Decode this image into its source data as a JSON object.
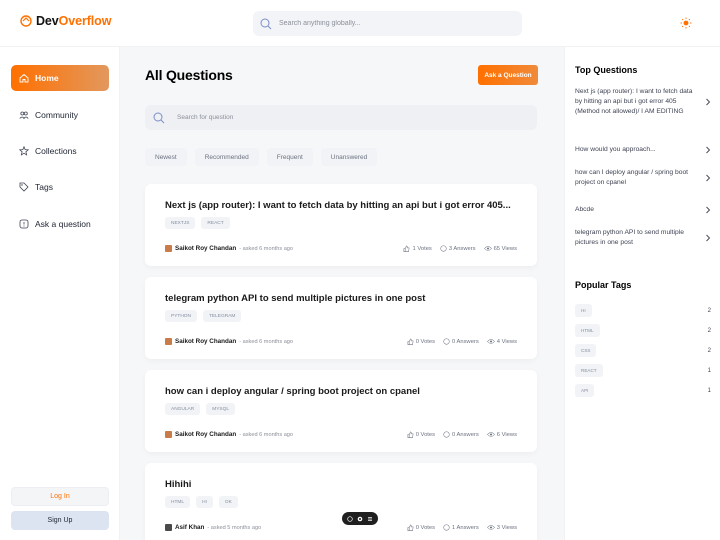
{
  "header": {
    "logo_prefix": "Dev",
    "logo_suffix": "Overflow",
    "search_placeholder": "Search anything globally..."
  },
  "sidebar": {
    "items": [
      {
        "label": "Home",
        "icon": "home-icon",
        "active": true
      },
      {
        "label": "Community",
        "icon": "users-icon",
        "active": false
      },
      {
        "label": "Collections",
        "icon": "star-icon",
        "active": false
      },
      {
        "label": "Tags",
        "icon": "tag-icon",
        "active": false
      },
      {
        "label": "Ask a question",
        "icon": "question-icon",
        "active": false
      }
    ],
    "login_label": "Log In",
    "signup_label": "Sign Up"
  },
  "main": {
    "title": "All Questions",
    "ask_button": "Ask a Question",
    "search_placeholder": "Search for question",
    "filters": [
      "Newest",
      "Recommended",
      "Frequent",
      "Unanswered"
    ],
    "questions": [
      {
        "title": "Next js (app router): I want to fetch data by hitting an api but i got error 405...",
        "tags": [
          "NEXTJS",
          "REACT"
        ],
        "author": "Saikot Roy Chandan",
        "time": "- asked 6 months ago",
        "votes": "1 Votes",
        "answers": "3 Answers",
        "views": "65 Views"
      },
      {
        "title": "telegram python API to send multiple pictures in one post",
        "tags": [
          "PYTHON",
          "TELEGRAM"
        ],
        "author": "Saikot Roy Chandan",
        "time": "- asked 6 months ago",
        "votes": "0 Votes",
        "answers": "0 Answers",
        "views": "4 Views"
      },
      {
        "title": "how can i deploy angular / spring boot project on cpanel",
        "tags": [
          "ANGULAR",
          "MYSQL"
        ],
        "author": "Saikot Roy Chandan",
        "time": "- asked 6 months ago",
        "votes": "0 Votes",
        "answers": "0 Answers",
        "views": "6 Views"
      },
      {
        "title": "Hihihi",
        "tags": [
          "HTML",
          "HI",
          "OK"
        ],
        "author": "Asif Khan",
        "time": "- asked 5 months ago",
        "votes": "0 Votes",
        "answers": "1 Answers",
        "views": "3 Views"
      }
    ]
  },
  "right": {
    "top_questions_title": "Top Questions",
    "top_questions": [
      "Next js (app router): I want to fetch data by hitting an api but i got error 405 (Method not allowed)/ I AM EDITING",
      "How would you approach...",
      "how can I deploy angular / spring boot project on cpanel",
      "Abcde",
      "telegram python API to send multiple pictures in one post"
    ],
    "popular_tags_title": "Popular Tags",
    "popular_tags": [
      {
        "name": "HI",
        "count": "2"
      },
      {
        "name": "HTML",
        "count": "2"
      },
      {
        "name": "CSS",
        "count": "2"
      },
      {
        "name": "REACT",
        "count": "1"
      },
      {
        "name": "API",
        "count": "1"
      }
    ]
  },
  "colors": {
    "accent": "#ff7000",
    "background": "#f6f7f9",
    "card": "#ffffff"
  }
}
